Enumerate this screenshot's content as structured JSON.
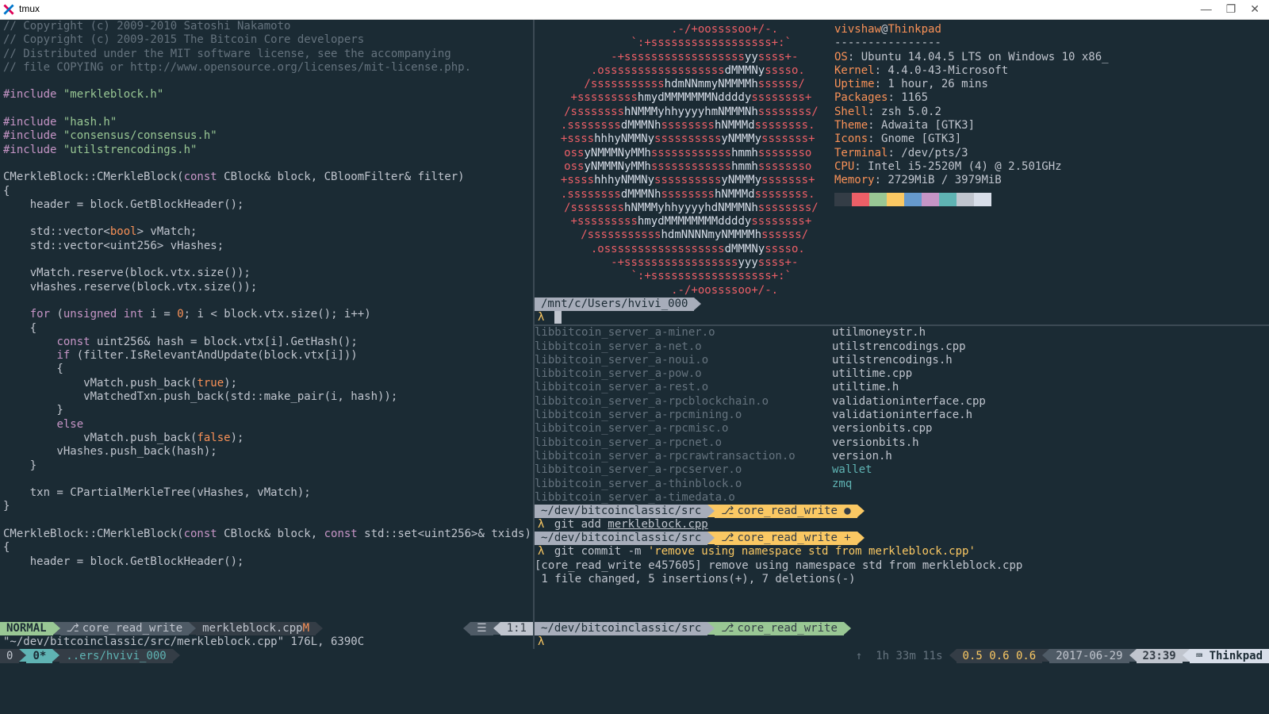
{
  "window": {
    "title": "tmux"
  },
  "code": {
    "lines": [
      {
        "t": "comment",
        "s": "// Copyright (c) 2009-2010 Satoshi Nakamoto"
      },
      {
        "t": "comment",
        "s": "// Copyright (c) 2009-2015 The Bitcoin Core developers"
      },
      {
        "t": "comment",
        "s": "// Distributed under the MIT software license, see the accompanying"
      },
      {
        "t": "comment",
        "s": "// file COPYING or http://www.opensource.org/licenses/mit-license.php."
      },
      {
        "t": "blank",
        "s": ""
      },
      {
        "t": "include",
        "d": "#include ",
        "q": "\"merkleblock.h\""
      },
      {
        "t": "blank",
        "s": ""
      },
      {
        "t": "include",
        "d": "#include ",
        "q": "\"hash.h\""
      },
      {
        "t": "include",
        "d": "#include ",
        "q": "\"consensus/consensus.h\""
      },
      {
        "t": "include",
        "d": "#include ",
        "q": "\"utilstrencodings.h\""
      },
      {
        "t": "blank",
        "s": ""
      },
      {
        "t": "sig1",
        "s": "CMerkleBlock::CMerkleBlock(const CBlock& block, CBloomFilter& filter)"
      },
      {
        "t": "plain",
        "s": "{"
      },
      {
        "t": "plain",
        "s": "    header = block.GetBlockHeader();"
      },
      {
        "t": "blank",
        "s": ""
      },
      {
        "t": "vec1",
        "s": "    std::vector<bool> vMatch;"
      },
      {
        "t": "plain",
        "s": "    std::vector<uint256> vHashes;"
      },
      {
        "t": "blank",
        "s": ""
      },
      {
        "t": "plain",
        "s": "    vMatch.reserve(block.vtx.size());"
      },
      {
        "t": "plain",
        "s": "    vHashes.reserve(block.vtx.size());"
      },
      {
        "t": "blank",
        "s": ""
      },
      {
        "t": "for",
        "s": "    for (unsigned int i = 0; i < block.vtx.size(); i++)"
      },
      {
        "t": "plain",
        "s": "    {"
      },
      {
        "t": "hash",
        "s": "        const uint256& hash = block.vtx[i].GetHash();"
      },
      {
        "t": "if",
        "s": "        if (filter.IsRelevantAndUpdate(block.vtx[i]))"
      },
      {
        "t": "plain",
        "s": "        {"
      },
      {
        "t": "push1",
        "s": "            vMatch.push_back(true);"
      },
      {
        "t": "plain",
        "s": "            vMatchedTxn.push_back(std::make_pair(i, hash));"
      },
      {
        "t": "plain",
        "s": "        }"
      },
      {
        "t": "else",
        "s": "        else"
      },
      {
        "t": "push2",
        "s": "            vMatch.push_back(false);"
      },
      {
        "t": "plain",
        "s": "        vHashes.push_back(hash);"
      },
      {
        "t": "plain",
        "s": "    }"
      },
      {
        "t": "blank",
        "s": ""
      },
      {
        "t": "plain",
        "s": "    txn = CPartialMerkleTree(vHashes, vMatch);"
      },
      {
        "t": "plain",
        "s": "}"
      },
      {
        "t": "blank",
        "s": ""
      },
      {
        "t": "sig2",
        "s": "CMerkleBlock::CMerkleBlock(const CBlock& block, const std::set<uint256>& txids)"
      },
      {
        "t": "plain",
        "s": "{"
      },
      {
        "t": "plain",
        "s": "    header = block.GetBlockHeader();"
      }
    ]
  },
  "vim_status": {
    "mode": "NORMAL",
    "branch": "core_read_write",
    "file": "merkleblock.cpp",
    "modified": "M",
    "pos": "1:1",
    "icon": "☰",
    "fileinfo": "\"~/dev/bitcoinclassic/src/merkleblock.cpp\" 176L, 6390C"
  },
  "neofetch": {
    "user": "vivshaw",
    "at": "@",
    "host": "Thinkpad",
    "sep": "----------------",
    "rows": [
      {
        "k": "OS",
        "v": ": Ubuntu 14.04.5 LTS on Windows 10 x86_"
      },
      {
        "k": "Kernel",
        "v": ": 4.4.0-43-Microsoft"
      },
      {
        "k": "Uptime",
        "v": ": 1 hour, 26 mins"
      },
      {
        "k": "Packages",
        "v": ": 1165"
      },
      {
        "k": "Shell",
        "v": ": zsh 5.0.2"
      },
      {
        "k": "Theme",
        "v": ": Adwaita [GTK3]"
      },
      {
        "k": "Icons",
        "v": ": Gnome [GTK3]"
      },
      {
        "k": "Terminal",
        "v": ": /dev/pts/3"
      },
      {
        "k": "CPU",
        "v": ": Intel i5-2520M (4) @ 2.501GHz"
      },
      {
        "k": "Memory",
        "v": ": 2729MiB / 3979MiB"
      }
    ],
    "colors": [
      "#343d46",
      "#ec5f67",
      "#99c794",
      "#fac863",
      "#6699cc",
      "#c695c6",
      "#5fb3b3",
      "#c0c5ce",
      "#d8dee9"
    ],
    "prompt_path": "/mnt/c/Users/hvivi_000",
    "lambda": "λ"
  },
  "files_left": [
    "libbitcoin_server_a-miner.o",
    "libbitcoin_server_a-net.o",
    "libbitcoin_server_a-noui.o",
    "libbitcoin_server_a-pow.o",
    "libbitcoin_server_a-rest.o",
    "libbitcoin_server_a-rpcblockchain.o",
    "libbitcoin_server_a-rpcmining.o",
    "libbitcoin_server_a-rpcmisc.o",
    "libbitcoin_server_a-rpcnet.o",
    "libbitcoin_server_a-rpcrawtransaction.o",
    "libbitcoin_server_a-rpcserver.o",
    "libbitcoin_server_a-thinblock.o",
    "libbitcoin_server_a-timedata.o"
  ],
  "files_right": [
    "utilmoneystr.h",
    "utilstrencodings.cpp",
    "utilstrencodings.h",
    "utiltime.cpp",
    "utiltime.h",
    "validationinterface.cpp",
    "validationinterface.h",
    "versionbits.cpp",
    "versionbits.h",
    "version.h",
    "wallet",
    "zmq"
  ],
  "git": {
    "path": "~/dev/bitcoinclassic/src",
    "branch": "core_read_write",
    "add_cmd": "git add ",
    "add_file": "merkleblock.cpp",
    "commit_cmd": "git commit -m ",
    "commit_msg": "'remove using namespace std from merkleblock.cpp'",
    "out1": "[core_read_write e457605] remove using namespace std from merkleblock.cpp",
    "out2": " 1 file changed, 5 insertions(+), 7 deletions(-)",
    "dirty": "●",
    "ahead": "+"
  },
  "tmux": {
    "session": "0",
    "window": "0*",
    "path": "..ers/hvivi_000",
    "up_arrow": "↑",
    "uptime": "1h 33m 11s",
    "load": "0.5 0.6 0.6",
    "date": "2017-06-29",
    "time": "23:39",
    "host_icon": "⌨",
    "host": "Thinkpad"
  }
}
